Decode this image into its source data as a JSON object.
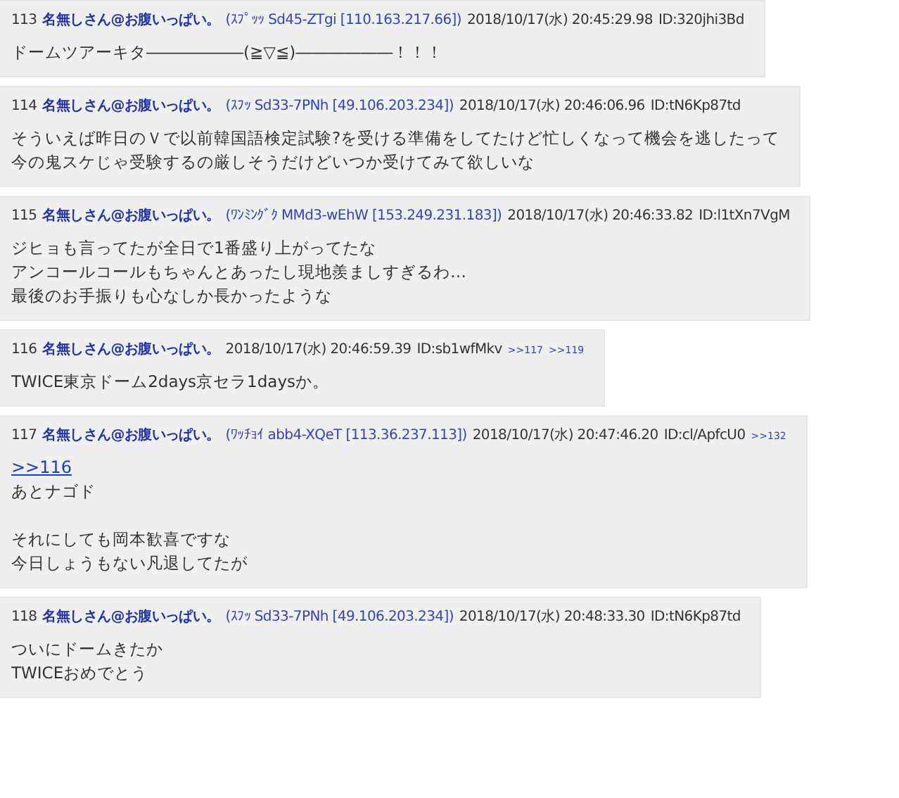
{
  "posts": [
    {
      "number": "113",
      "name": "名無しさん@お腹いっぱい。",
      "id_info": "(ｽﾌﾟｯｯ Sd45-ZTgi [110.163.217.66])",
      "date": "2018/10/17(水) 20:45:29.98",
      "user_id": "ID:320jhi3Bd",
      "paragraphs": [
        [
          "ドームツアーキタ――――――(≧▽≦)――――――！！！"
        ]
      ]
    },
    {
      "number": "114",
      "name": "名無しさん@お腹いっぱい。",
      "id_info": "(ｽﾌｯ Sd33-7PNh [49.106.203.234])",
      "date": "2018/10/17(水) 20:46:06.96",
      "user_id": "ID:tN6Kp87td",
      "paragraphs": [
        [
          "そういえば昨日のＶで以前韓国語検定試験?を受ける準備をしてたけど忙しくなって機会を逃したって",
          "今の鬼スケじゃ受験するの厳しそうだけどいつか受けてみて欲しいな"
        ]
      ]
    },
    {
      "number": "115",
      "name": "名無しさん@お腹いっぱい。",
      "id_info": "(ﾜﾝﾐﾝｸﾞｸ MMd3-wEhW [153.249.231.183])",
      "date": "2018/10/17(水) 20:46:33.82",
      "user_id": "ID:l1tXn7VgM",
      "paragraphs": [
        [
          "ジヒョも言ってたが全日で1番盛り上がってたな",
          "アンコールコールもちゃんとあったし現地羨ましすぎるわ…",
          "最後のお手振りも心なしか長かったような"
        ]
      ]
    },
    {
      "number": "116",
      "name": "名無しさん@お腹いっぱい。",
      "date": "2018/10/17(水) 20:46:59.39",
      "user_id": "ID:sb1wfMkv",
      "backlinks": [
        ">>117",
        ">>119"
      ],
      "paragraphs": [
        [
          "TWICE東京ドーム2days京セラ1daysか。"
        ]
      ]
    },
    {
      "number": "117",
      "name": "名無しさん@お腹いっぱい。",
      "id_info": "(ﾜｯﾁｮｲ abb4-XQeT [113.36.237.113])",
      "date": "2018/10/17(水) 20:47:46.20",
      "user_id": "ID:cl/ApfcU0",
      "backlinks": [
        ">>132"
      ],
      "reply_link": ">>116",
      "paragraphs": [
        [
          "あとナゴド"
        ],
        [
          "それにしても岡本歓喜ですな",
          "今日しょうもない凡退してたが"
        ]
      ]
    },
    {
      "number": "118",
      "name": "名無しさん@お腹いっぱい。",
      "id_info": "(ｽﾌｯ Sd33-7PNh [49.106.203.234])",
      "date": "2018/10/17(水) 20:48:33.30",
      "user_id": "ID:tN6Kp87td",
      "paragraphs": [
        [
          "ついにドームきたか",
          "TWICEおめでとう"
        ]
      ]
    }
  ]
}
